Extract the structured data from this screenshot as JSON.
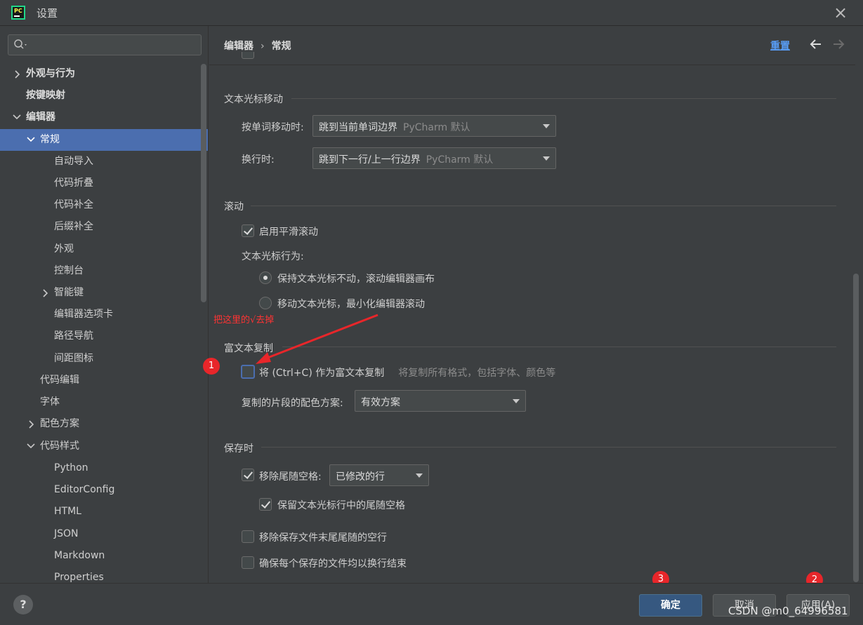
{
  "window": {
    "title": "设置",
    "close_icon": "×"
  },
  "sidebar": {
    "search_placeholder": "",
    "items": [
      {
        "label": "外观与行为"
      },
      {
        "label": "按键映射"
      },
      {
        "label": "编辑器"
      },
      {
        "label": "常规"
      },
      {
        "label": "自动导入"
      },
      {
        "label": "代码折叠"
      },
      {
        "label": "代码补全"
      },
      {
        "label": "后缀补全"
      },
      {
        "label": "外观"
      },
      {
        "label": "控制台"
      },
      {
        "label": "智能键"
      },
      {
        "label": "编辑器选项卡"
      },
      {
        "label": "路径导航"
      },
      {
        "label": "间距图标"
      },
      {
        "label": "代码编辑"
      },
      {
        "label": "字体"
      },
      {
        "label": "配色方案"
      },
      {
        "label": "代码样式"
      },
      {
        "label": "Python"
      },
      {
        "label": "EditorConfig"
      },
      {
        "label": "HTML"
      },
      {
        "label": "JSON"
      },
      {
        "label": "Markdown"
      },
      {
        "label": "Properties"
      }
    ]
  },
  "header": {
    "breadcrumb_parent": "编辑器",
    "breadcrumb_sep": "›",
    "breadcrumb_current": "常规",
    "reset_label": "重置"
  },
  "caret_movement": {
    "title": "文本光标移动",
    "word_label": "按单词移动时:",
    "word_value": "跳到当前单词边界",
    "word_hint": "PyCharm 默认",
    "line_label": "换行时:",
    "line_value": "跳到下一行/上一行边界",
    "line_hint": "PyCharm 默认"
  },
  "scrolling": {
    "title": "滚动",
    "smooth_label": "启用平滑滚动",
    "smooth_checked": true,
    "caret_behavior_label": "文本光标行为:",
    "radio1_label": "保持文本光标不动，滚动编辑器画布",
    "radio2_label": "移动文本光标，最小化编辑器滚动"
  },
  "rich_copy": {
    "title": "富文本复制",
    "copy_label": "将 (Ctrl+C) 作为富文本复制",
    "copy_hint": "将复制所有格式，包括字体、颜色等",
    "copy_checked": false,
    "scheme_label": "复制的片段的配色方案:",
    "scheme_value": "有效方案"
  },
  "on_save": {
    "title": "保存时",
    "strip_label": "移除尾随空格:",
    "strip_checked": true,
    "strip_value": "已修改的行",
    "keep_caret_label": "保留文本光标行中的尾随空格",
    "keep_caret_checked": true,
    "remove_blank_label": "移除保存文件末尾尾随的空行",
    "ensure_newline_label": "确保每个保存的文件均以换行结束"
  },
  "annotations": {
    "instruction": "把这里的√去掉",
    "badge1": "1",
    "badge2": "2",
    "badge3": "3",
    "color": "#e8262a"
  },
  "footer": {
    "help_label": "?",
    "ok_label": "确定",
    "cancel_label": "取消",
    "apply_label": "应用(A)"
  },
  "watermark": "CSDN @m0_64996581",
  "colors": {
    "background": "#3c3f41",
    "selection": "#4b6eaf",
    "link": "#589df6",
    "primary_button": "#365880"
  }
}
